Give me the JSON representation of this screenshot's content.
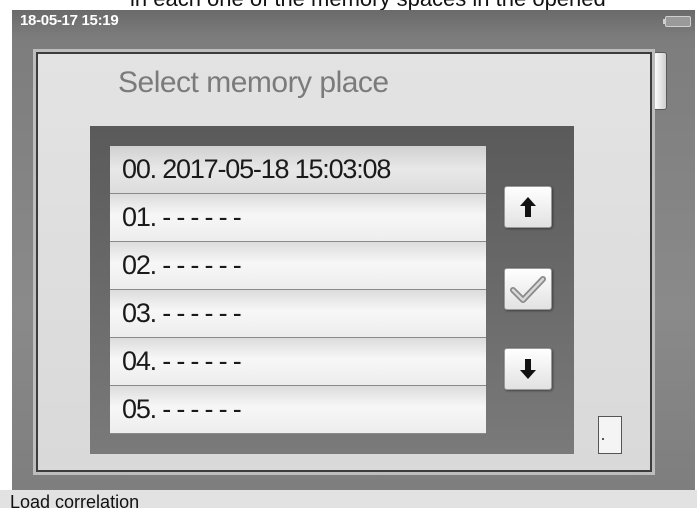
{
  "window": {
    "caption": "in each one of the memory spaces in the opened",
    "status": {
      "datetime": "18-05-17 15:19"
    },
    "bottom_label": "Load correlation"
  },
  "dialog": {
    "title": "Select memory place",
    "items": [
      {
        "label": "00. 2017-05-18 15:03:08",
        "selected": true
      },
      {
        "label": "01. - - - - - -"
      },
      {
        "label": "02. - - - - - -"
      },
      {
        "label": "03. - - - - - -"
      },
      {
        "label": "04. - - - - - -"
      },
      {
        "label": "05. - - - - - -"
      }
    ],
    "buttons": {
      "up": "arrow-up-icon",
      "confirm": "checkmark-icon",
      "down": "arrow-down-icon"
    }
  }
}
